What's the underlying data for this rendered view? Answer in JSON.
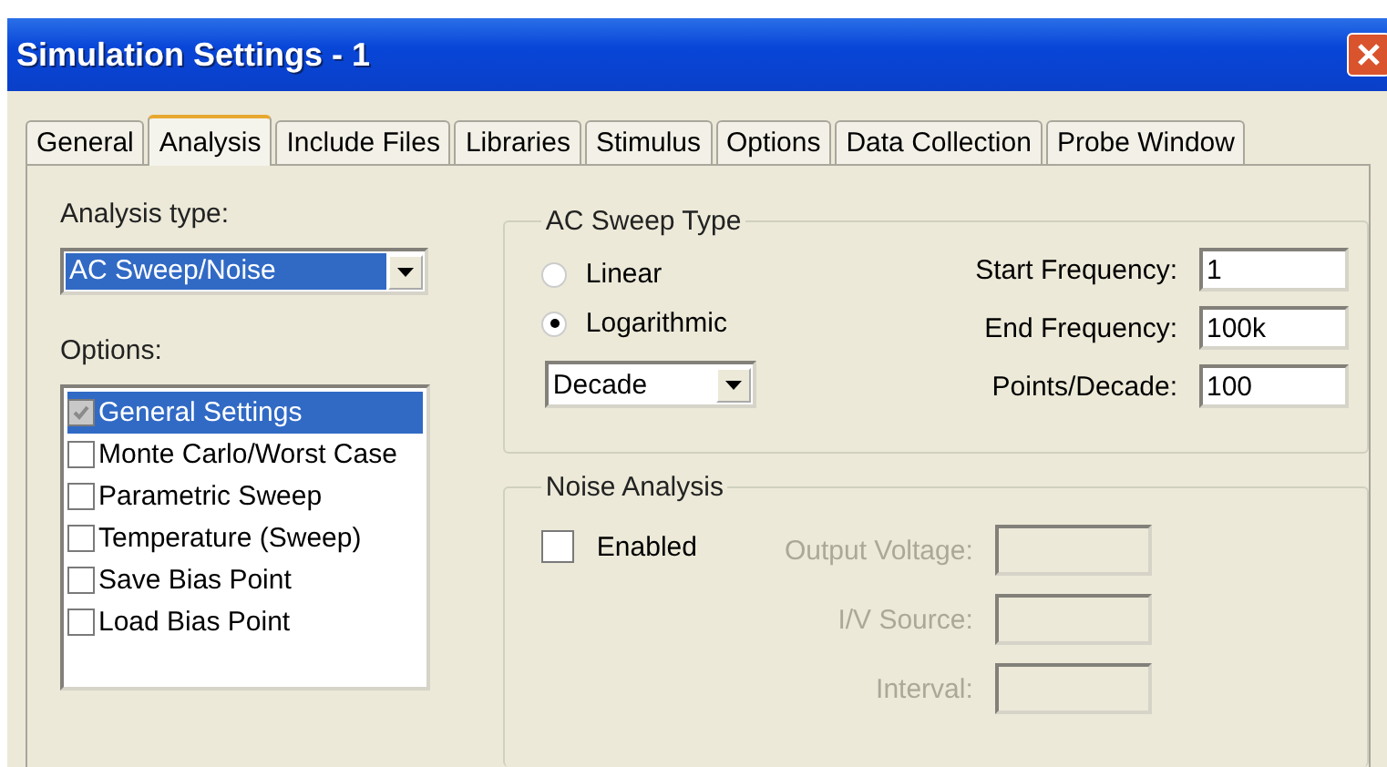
{
  "window": {
    "title": "Simulation Settings - 1"
  },
  "tabs": [
    {
      "label": "General",
      "selected": false
    },
    {
      "label": "Analysis",
      "selected": true
    },
    {
      "label": "Include Files",
      "selected": false
    },
    {
      "label": "Libraries",
      "selected": false
    },
    {
      "label": "Stimulus",
      "selected": false
    },
    {
      "label": "Options",
      "selected": false
    },
    {
      "label": "Data Collection",
      "selected": false
    },
    {
      "label": "Probe Window",
      "selected": false
    }
  ],
  "analysis_type": {
    "label": "Analysis type:",
    "value": "AC Sweep/Noise"
  },
  "options": {
    "label": "Options:",
    "items": [
      {
        "label": "General Settings",
        "checked": true,
        "disabled": true,
        "selected": true
      },
      {
        "label": "Monte Carlo/Worst Case",
        "checked": false,
        "disabled": false,
        "selected": false
      },
      {
        "label": "Parametric Sweep",
        "checked": false,
        "disabled": false,
        "selected": false
      },
      {
        "label": "Temperature (Sweep)",
        "checked": false,
        "disabled": false,
        "selected": false
      },
      {
        "label": "Save Bias Point",
        "checked": false,
        "disabled": false,
        "selected": false
      },
      {
        "label": "Load Bias Point",
        "checked": false,
        "disabled": false,
        "selected": false
      }
    ]
  },
  "ac_sweep": {
    "title": "AC Sweep Type",
    "radios": [
      {
        "label": "Linear",
        "selected": false
      },
      {
        "label": "Logarithmic",
        "selected": true
      }
    ],
    "unit": {
      "value": "Decade"
    },
    "fields": [
      {
        "label": "Start Frequency:",
        "value": "1",
        "disabled": false
      },
      {
        "label": "End Frequency:",
        "value": "100k",
        "disabled": false
      },
      {
        "label": "Points/Decade:",
        "value": "100",
        "disabled": false
      }
    ]
  },
  "noise": {
    "title": "Noise Analysis",
    "enabled": {
      "label": "Enabled",
      "checked": false
    },
    "fields": [
      {
        "label": "Output Voltage:",
        "disabled": true
      },
      {
        "label": "I/V Source:",
        "disabled": true
      },
      {
        "label": "Interval:",
        "disabled": true
      }
    ]
  }
}
